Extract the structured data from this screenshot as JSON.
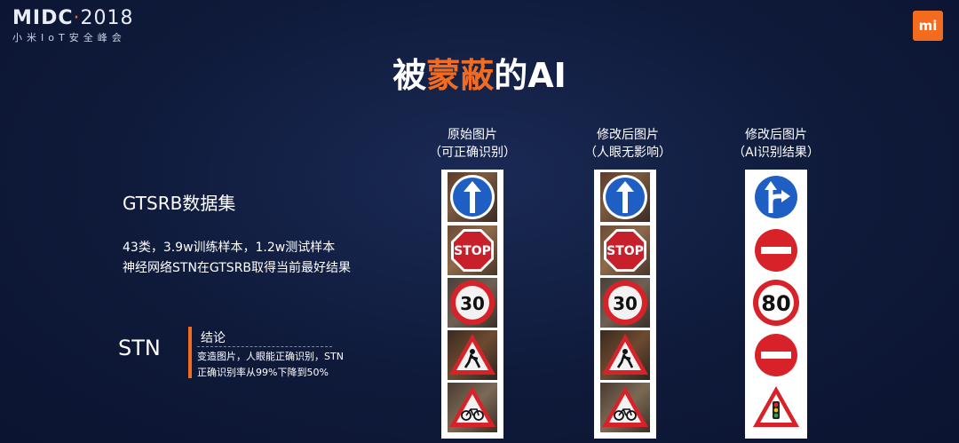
{
  "header": {
    "logo_brand": "MIDC",
    "logo_dot": "·",
    "logo_year": "2018",
    "logo_subtitle": "小米IoT安全峰会",
    "mi_logo": "mi"
  },
  "title": {
    "part1": "被",
    "highlight": "蒙蔽",
    "part2": "的AI"
  },
  "left": {
    "dataset": "GTSRB数据集",
    "stats_line1": "43类，3.9w训练样本，1.2w测试样本",
    "stats_line2": "神经网络STN在GTSRB取得当前最好结果",
    "stn": "STN",
    "conclusion_title": "结论",
    "conclusion_line1": "变造图片，人眼能正确识别，STN",
    "conclusion_line2": "正确识别率从99%下降到50%"
  },
  "columns": [
    {
      "line1": "原始图片",
      "line2": "（可正确识别）"
    },
    {
      "line1": "修改后图片",
      "line2": "（人眼无影响）"
    },
    {
      "line1": "修改后图片",
      "line2": "（AI识别结果）"
    }
  ],
  "signs": {
    "original": [
      "ahead-only-sign",
      "stop-sign",
      "speed-limit-30-sign",
      "road-work-sign",
      "bicycle-crossing-sign"
    ],
    "modified": [
      "ahead-only-sign",
      "stop-sign",
      "speed-limit-30-sign",
      "road-work-sign",
      "bicycle-crossing-sign"
    ],
    "ai_result": [
      "ahead-or-right-sign",
      "no-entry-sign",
      "speed-limit-80-sign",
      "no-entry-sign",
      "traffic-signals-warning-sign"
    ]
  },
  "sign_text": {
    "stop": "STOP",
    "speed_30": "30",
    "speed_80": "80"
  },
  "colors": {
    "accent": "#f26b1f",
    "sign_blue": "#1f5fc4",
    "sign_red": "#d8222a"
  }
}
